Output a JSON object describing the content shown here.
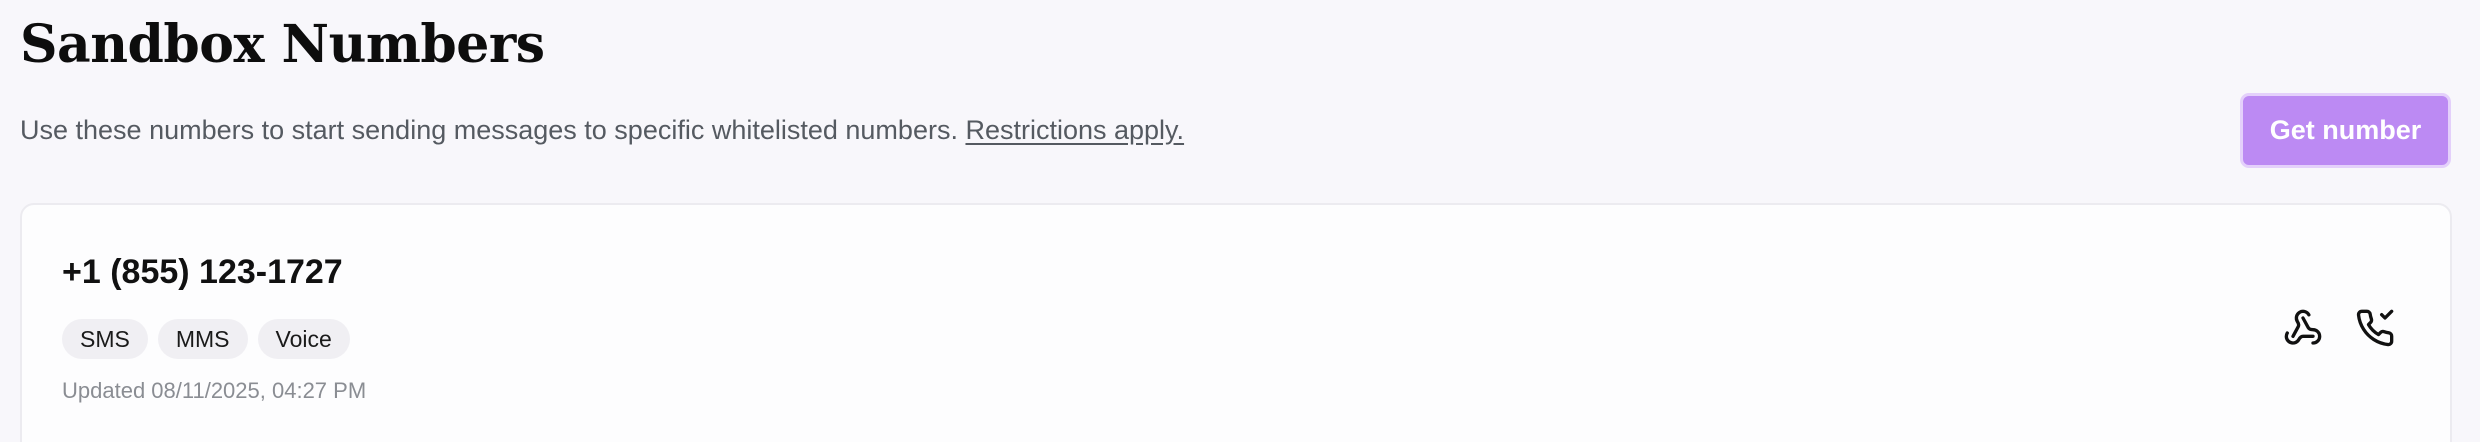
{
  "header": {
    "title": "Sandbox Numbers",
    "subtitle": "Use these numbers to start sending messages to specific whitelisted numbers.",
    "restrictions_link": "Restrictions apply.",
    "get_number_label": "Get number"
  },
  "numbers": [
    {
      "phone": "+1 (855) 123-1727",
      "capabilities": [
        "SMS",
        "MMS",
        "Voice"
      ],
      "updated": "Updated 08/11/2025, 04:27 PM",
      "actions": [
        {
          "icon": "webhook-icon"
        },
        {
          "icon": "phone-check-icon"
        }
      ]
    }
  ],
  "colors": {
    "background": "#f8f7fb",
    "accent_button": "#bc8af3",
    "card_background": "#fdfdfe",
    "badge_background": "#f0eff3"
  }
}
